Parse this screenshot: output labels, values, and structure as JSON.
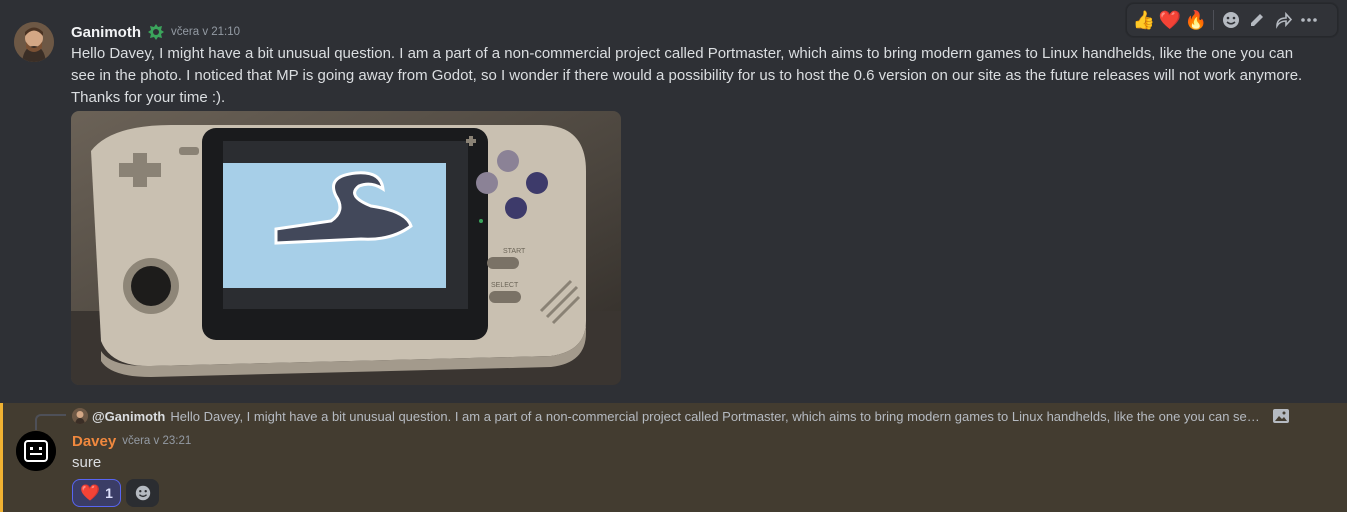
{
  "message1": {
    "author": "Ganimoth",
    "role_icon": "green-badge-icon",
    "timestamp": "včera v 21:10",
    "text": "Hello Davey, I might have a bit unusual question. I am a part of a non-commercial project called Portmaster, which aims to bring modern games to Linux handhelds, like the one you can see in the photo. I noticed that MP is going away from Godot, so I wonder if there would a possibility for us to host the 0.6 version on our site as the future releases will not work anymore. Thanks for your time :).",
    "attachment": {
      "type": "photo",
      "screen_text": {
        "start": "START",
        "select": "SELECT"
      }
    }
  },
  "toolbar": {
    "quick_reactions": [
      "👍",
      "❤️",
      "🔥"
    ],
    "actions": [
      "add-reaction-icon",
      "edit-icon",
      "forward-icon",
      "more-icon"
    ]
  },
  "message2": {
    "reply": {
      "author": "@Ganimoth",
      "snippet": "Hello Davey, I might have a bit unusual question. I am a part of a non-commercial project called Portmaster, which aims to bring modern games to Linux handhelds, like the one you can se…"
    },
    "author": "Davey",
    "timestamp": "včera v 23:21",
    "text": "sure",
    "reaction": {
      "emoji": "❤️",
      "count": "1"
    }
  },
  "colors": {
    "background": "#313338",
    "highlight_bg": "#433c30",
    "mention_bar": "#f0b232",
    "author2": "#f0883e",
    "reaction_border": "#5865f2"
  }
}
